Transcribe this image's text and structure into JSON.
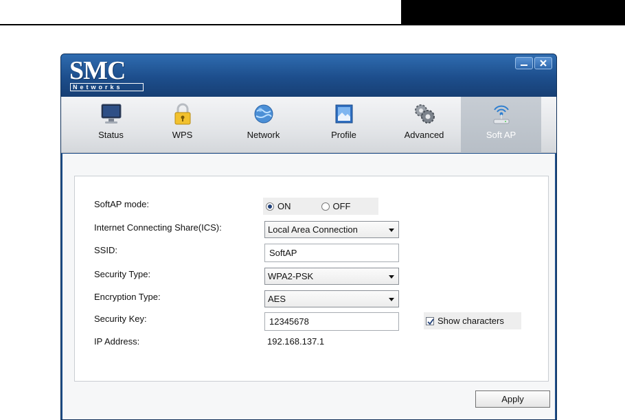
{
  "window": {
    "brand": {
      "name": "SMC",
      "sub": "Networks"
    }
  },
  "toolbar": {
    "items": [
      {
        "label": "Status",
        "icon": "monitor-icon"
      },
      {
        "label": "WPS",
        "icon": "lock-icon"
      },
      {
        "label": "Network",
        "icon": "globe-icon"
      },
      {
        "label": "Profile",
        "icon": "profile-icon"
      },
      {
        "label": "Advanced",
        "icon": "gears-icon"
      },
      {
        "label": "Soft AP",
        "icon": "access-point-icon",
        "active": true
      }
    ]
  },
  "softap": {
    "mode_label": "SoftAP mode:",
    "mode_on": "ON",
    "mode_off": "OFF",
    "mode_selected": "ON",
    "ics_label": "Internet Connecting Share(ICS):",
    "ics_value": "Local Area Connection",
    "ssid_label": "SSID:",
    "ssid_value": "SoftAP",
    "security_type_label": "Security Type:",
    "security_type_value": "WPA2-PSK",
    "encryption_type_label": "Encryption Type:",
    "encryption_type_value": "AES",
    "security_key_label": "Security Key:",
    "security_key_value": "12345678",
    "show_characters_label": "Show characters",
    "show_characters_checked": true,
    "ip_label": "IP Address:",
    "ip_value": "192.168.137.1"
  },
  "actions": {
    "apply_label": "Apply"
  },
  "colors": {
    "titlebar": "#1d4e8c",
    "active_tab": "#b7bec6",
    "radio_selected": "#1f3f78"
  }
}
